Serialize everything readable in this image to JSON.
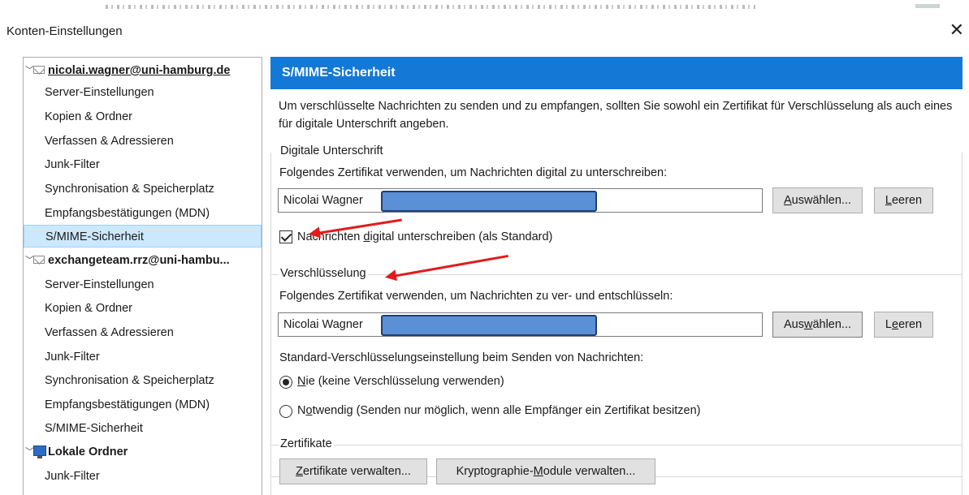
{
  "window": {
    "title": "Konten-Einstellungen"
  },
  "tree": {
    "accounts": [
      {
        "name": "nicolai.wagner@uni-hamburg.de",
        "items": [
          "Server-Einstellungen",
          "Kopien & Ordner",
          "Verfassen & Adressieren",
          "Junk-Filter",
          "Synchronisation & Speicherplatz",
          "Empfangsbestätigungen (MDN)",
          "S/MIME-Sicherheit"
        ]
      },
      {
        "name": "exchangeteam.rrz@uni-hambu...",
        "items": [
          "Server-Einstellungen",
          "Kopien & Ordner",
          "Verfassen & Adressieren",
          "Junk-Filter",
          "Synchronisation & Speicherplatz",
          "Empfangsbestätigungen (MDN)",
          "S/MIME-Sicherheit"
        ]
      },
      {
        "name": "Lokale Ordner",
        "items": [
          "Junk-Filter"
        ]
      }
    ],
    "selected": "S/MIME-Sicherheit"
  },
  "panel": {
    "header": "S/MIME-Sicherheit",
    "intro": "Um verschlüsselte Nachrichten zu senden und zu empfangen, sollten Sie sowohl ein Zertifikat für Verschlüsselung als auch eines für digitale Unterschrift angeben.",
    "signing": {
      "legend": "Digitale Unterschrift",
      "label": "Folgendes Zertifikat verwenden, um Nachrichten digital zu unterschreiben:",
      "cert_value": "Nicolai Wagner",
      "select_button": {
        "pre": "",
        "key": "A",
        "post": "uswählen..."
      },
      "clear_button": {
        "pre": "",
        "key": "L",
        "post": "eeren"
      },
      "checkbox": {
        "pre": "Nachrichten ",
        "key": "d",
        "post": "igital unterschreiben (als Standard)",
        "checked": true
      }
    },
    "encryption": {
      "legend": "Verschlüsselung",
      "label": "Folgendes Zertifikat verwenden, um Nachrichten zu ver- und entschlüsseln:",
      "cert_value": "Nicolai Wagner",
      "select_button": {
        "pre": "Aus",
        "key": "w",
        "post": "ählen..."
      },
      "clear_button": {
        "pre": "L",
        "key": "e",
        "post": "eren"
      },
      "default_label": "Standard-Verschlüsselungseinstellung beim Senden von Nachrichten:",
      "option_never": {
        "pre": "",
        "key": "N",
        "post": "ie (keine Verschlüsselung verwenden)",
        "selected": true
      },
      "option_required": {
        "pre": "N",
        "key": "o",
        "post": "twendig (Senden nur möglich, wenn alle Empfänger ein Zertifikat besitzen)",
        "selected": false
      }
    },
    "certificates": {
      "legend": "Zertifikate",
      "manage_button": {
        "pre": "",
        "key": "Z",
        "post": "ertifikate verwalten..."
      },
      "modules_button": {
        "pre": "Kryptographie-",
        "key": "M",
        "post": "odule verwalten..."
      }
    }
  },
  "colors": {
    "header_bg": "#1479d6",
    "selection_bg": "#cce8ff",
    "annotation_arrow": "#e21b1b",
    "redaction": "#5b8fd6"
  }
}
